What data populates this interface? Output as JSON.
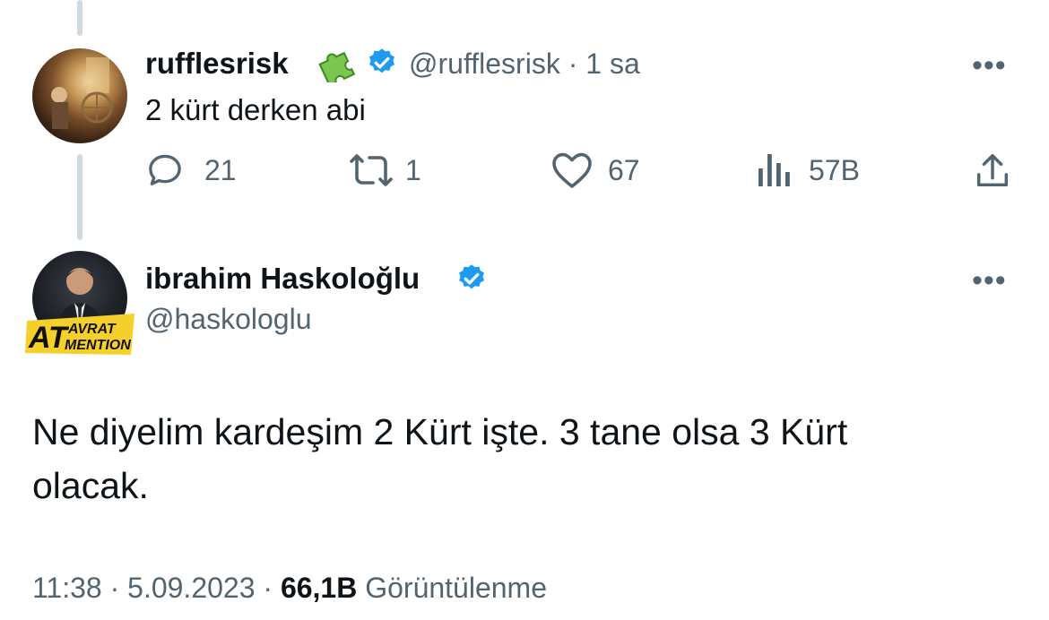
{
  "reply_tweet": {
    "display_name": "rufflesrisk",
    "handle": "@rufflesrisk",
    "time": "1 sa",
    "text": "2 kürt derken abi",
    "badge_icon": "puzzle-piece-icon",
    "verified_color": "#1d9bf0",
    "actions": {
      "replies": "21",
      "retweets": "1",
      "likes": "67",
      "views": "57B"
    }
  },
  "main_tweet": {
    "display_name": "ibrahim Haskoloğlu",
    "handle": "@haskologlu",
    "avatar_text": [
      "AVRAT",
      "AT",
      "MENTION"
    ],
    "text_line_1": "Ne diyelim kardeşim 2 Kürt işte. 3 tane olsa 3 Kürt",
    "text_line_2": "olacak.",
    "time": "11:38",
    "date": "5.09.2023",
    "views": "66,1B",
    "views_label": "Görüntülenme"
  },
  "colors": {
    "text": "#0f1419",
    "secondary": "#536471",
    "verified": "#1d9bf0",
    "thread_line": "#cfd9de"
  }
}
